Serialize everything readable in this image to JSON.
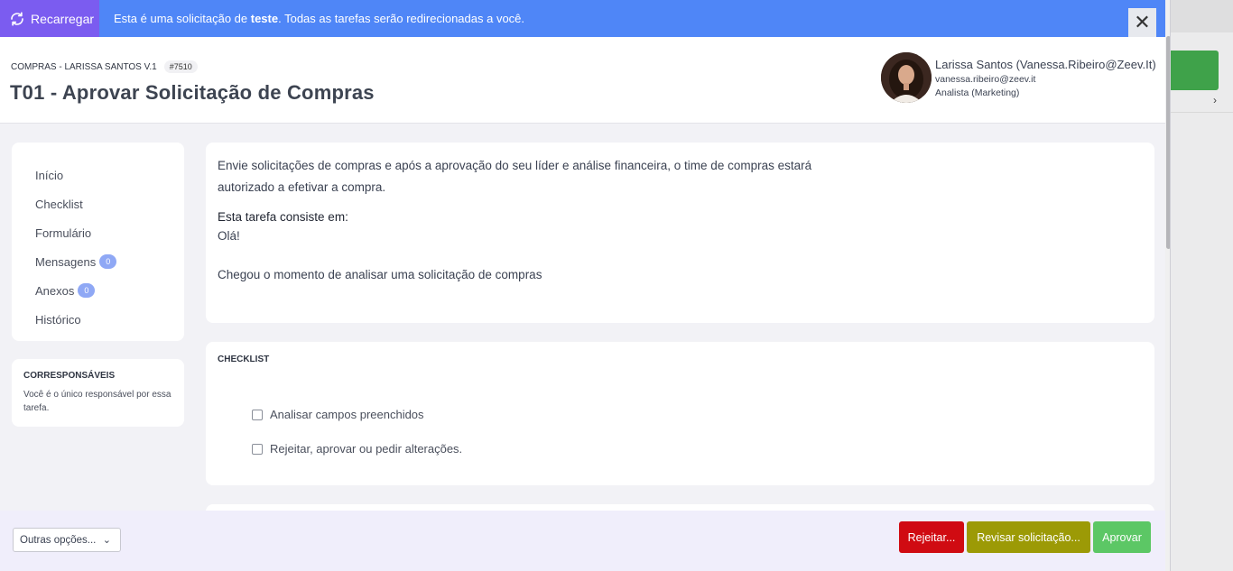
{
  "banner": {
    "reload_label": "Recarregar",
    "text_before": "Esta é uma solicitação de ",
    "text_bold": "teste",
    "text_after": ". Todas as tarefas serão redirecionadas a você.",
    "close_label": "✕"
  },
  "header": {
    "process": "COMPRAS - LARISSA SANTOS V.1",
    "request_id": "#7510",
    "title": "T01 - Aprovar Solicitação de Compras"
  },
  "user": {
    "name": "Larissa Santos (Vanessa.Ribeiro@Zeev.It)",
    "email": "vanessa.ribeiro@zeev.it",
    "role": "Analista (Marketing)"
  },
  "sidebar": {
    "items": [
      {
        "label": "Início"
      },
      {
        "label": "Checklist"
      },
      {
        "label": "Formulário"
      },
      {
        "label": "Mensagens",
        "count": "0"
      },
      {
        "label": "Anexos",
        "count": "0"
      },
      {
        "label": "Histórico"
      }
    ]
  },
  "coresp": {
    "title": "CORRESPONSÁVEIS",
    "text": "Você é o único responsável por essa tarefa."
  },
  "description": {
    "line1": "Envie solicitações de compras e após a aprovação do seu líder e análise financeira, o time de compras estará",
    "line2": "autorizado a efetivar a compra.",
    "task_label": "Esta tarefa consiste em:",
    "task_text": "Olá!",
    "task_text2": "Chegou o momento de analisar uma solicitação de compras"
  },
  "checklist": {
    "title": "CHECKLIST",
    "items": [
      {
        "label": "Analisar campos preenchidos",
        "checked": false
      },
      {
        "label": "Rejeitar, aprovar ou pedir alterações.",
        "checked": false
      }
    ]
  },
  "footer": {
    "other_options": "Outras opções...",
    "reject": "Rejeitar...",
    "review": "Revisar solicitação...",
    "approve": "Aprovar"
  },
  "colors": {
    "banner": "#4f86f7",
    "reload": "#7b5cf0",
    "reject": "#d00b12",
    "review": "#9c9a06",
    "approve": "#5cc765"
  }
}
